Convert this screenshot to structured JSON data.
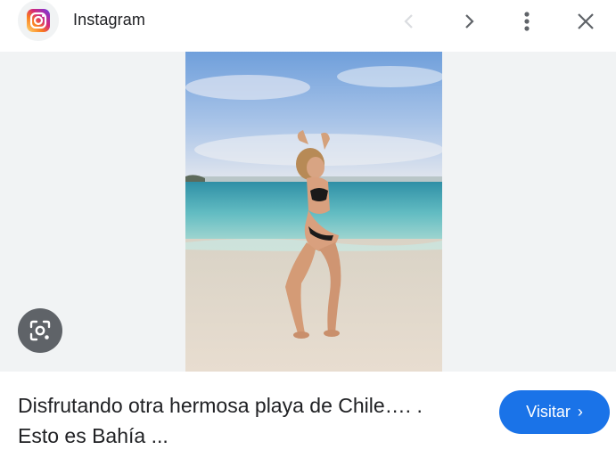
{
  "header": {
    "source_name": "Instagram",
    "source_icon": "instagram-icon",
    "actions": [
      "previous-icon",
      "next-icon",
      "more-vert-icon",
      "close-icon"
    ]
  },
  "preview": {
    "lens_icon": "google-lens-icon"
  },
  "result": {
    "caption_line1": "Disfrutando otra hermosa playa de Chile…. .",
    "caption_line2": "Esto es Bahía ...",
    "visit_label": "Visitar",
    "visit_chevron": "›"
  },
  "colors": {
    "accent": "#1a73e8",
    "panel": "#f1f3f4",
    "lens_button": "#5f6368",
    "text": "#202124"
  }
}
